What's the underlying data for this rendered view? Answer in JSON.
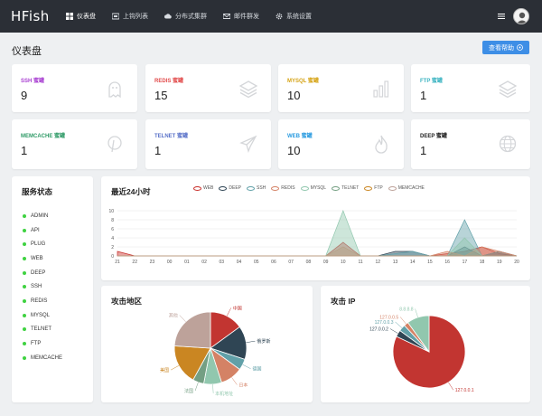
{
  "app": {
    "brand": "HFish"
  },
  "nav": [
    {
      "label": "仪表盘",
      "icon": "dashboard-icon"
    },
    {
      "label": "上钩列表",
      "icon": "hook-icon"
    },
    {
      "label": "分布式集群",
      "icon": "cloud-icon"
    },
    {
      "label": "邮件群发",
      "icon": "mail-icon"
    },
    {
      "label": "系统设置",
      "icon": "gear-icon"
    }
  ],
  "page": {
    "title": "仪表盘",
    "help_button": "查看帮助"
  },
  "stats": [
    {
      "label": "SSH 蜜罐",
      "value": "9",
      "color": "#a83ed1",
      "icon": "ghost-icon"
    },
    {
      "label": "REDIS 蜜罐",
      "value": "15",
      "color": "#e24c4c",
      "icon": "layers-icon"
    },
    {
      "label": "MYSQL 蜜罐",
      "value": "10",
      "color": "#d6a417",
      "icon": "bar-chart-icon"
    },
    {
      "label": "FTP 蜜罐",
      "value": "1",
      "color": "#3db4c2",
      "icon": "layers-icon"
    },
    {
      "label": "MEMCACHE 蜜罐",
      "value": "1",
      "color": "#2e9a66",
      "icon": "pinterest-icon"
    },
    {
      "label": "TELNET 蜜罐",
      "value": "1",
      "color": "#5b73c9",
      "icon": "airplane-icon"
    },
    {
      "label": "WEB 蜜罐",
      "value": "10",
      "color": "#2a9be0",
      "icon": "fire-icon"
    },
    {
      "label": "DEEP 蜜罐",
      "value": "1",
      "color": "#222222",
      "icon": "globe-icon"
    }
  ],
  "services": {
    "title": "服务状态",
    "items": [
      "ADMIN",
      "API",
      "PLUG",
      "WEB",
      "DEEP",
      "SSH",
      "REDIS",
      "MYSQL",
      "TELNET",
      "FTP",
      "MEMCACHE"
    ],
    "status_color": "#3fd241"
  },
  "chart_data": [
    {
      "type": "area",
      "title": "最近24小时",
      "x": [
        "21",
        "22",
        "23",
        "00",
        "01",
        "02",
        "03",
        "04",
        "05",
        "06",
        "07",
        "08",
        "09",
        "10",
        "11",
        "12",
        "13",
        "14",
        "15",
        "16",
        "17",
        "18",
        "19",
        "20"
      ],
      "ylim": [
        0,
        10
      ],
      "yticks": [
        0,
        2,
        4,
        6,
        8,
        10
      ],
      "series": [
        {
          "name": "WEB",
          "color": "#c9302c",
          "values": [
            1,
            0,
            0,
            0,
            0,
            0,
            0,
            0,
            0,
            0,
            0,
            0,
            0,
            3,
            0,
            0,
            0,
            0,
            0,
            0.5,
            1,
            2,
            0.5,
            0
          ]
        },
        {
          "name": "DEEP",
          "color": "#2f4554",
          "values": [
            0,
            0,
            0,
            0,
            0,
            0,
            0,
            0,
            0,
            0,
            0,
            0,
            0,
            0,
            0,
            0,
            1,
            1,
            0,
            0,
            2,
            0,
            1,
            0
          ]
        },
        {
          "name": "SSH",
          "color": "#61a0a8",
          "values": [
            0,
            0,
            0,
            0,
            0,
            0,
            0,
            0,
            0,
            0,
            0,
            0,
            0,
            0,
            0,
            0,
            0.5,
            1,
            0,
            0,
            8,
            0,
            1,
            0
          ]
        },
        {
          "name": "REDIS",
          "color": "#d48265",
          "values": [
            0,
            0,
            0,
            0,
            0,
            0,
            0,
            0,
            0,
            0,
            0,
            0,
            0,
            2,
            0,
            0,
            0,
            0,
            0,
            1,
            0,
            2,
            1,
            0
          ]
        },
        {
          "name": "MYSQL",
          "color": "#91c7ae",
          "values": [
            0,
            0,
            0,
            0,
            0,
            0,
            0,
            0,
            0,
            0,
            0,
            0,
            0,
            10,
            0,
            0,
            0,
            0,
            0,
            0,
            4,
            0,
            0,
            0
          ]
        },
        {
          "name": "TELNET",
          "color": "#749f83",
          "values": [
            0,
            0,
            0,
            0,
            0,
            0,
            0,
            0,
            0,
            0,
            0,
            0,
            0,
            0,
            0,
            0,
            0,
            0,
            0,
            0,
            0,
            0,
            0,
            0
          ]
        },
        {
          "name": "FTP",
          "color": "#ca8622",
          "values": [
            0,
            0,
            0,
            0,
            0,
            0,
            0,
            0,
            0,
            0,
            0,
            0,
            0,
            0,
            0,
            0,
            0,
            0,
            0,
            0,
            0,
            0,
            0,
            0
          ]
        },
        {
          "name": "MEMCACHE",
          "color": "#bda29a",
          "values": [
            0,
            0,
            0,
            0,
            0,
            0,
            0,
            0,
            0,
            0,
            0,
            0,
            0,
            0,
            0,
            0,
            0,
            0,
            0,
            0,
            0,
            0,
            0,
            0
          ]
        }
      ]
    },
    {
      "type": "pie",
      "title": "攻击地区",
      "slices": [
        {
          "label": "中国",
          "value": 15,
          "color": "#c23531"
        },
        {
          "label": "俄罗斯",
          "value": 15,
          "color": "#2f4554"
        },
        {
          "label": "德国",
          "value": 5,
          "color": "#61a0a8"
        },
        {
          "label": "日本",
          "value": 10,
          "color": "#d48265"
        },
        {
          "label": "本机地址",
          "value": 8,
          "color": "#91c7ae"
        },
        {
          "label": "法国",
          "value": 5,
          "color": "#749f83"
        },
        {
          "label": "美国",
          "value": 18,
          "color": "#ca8622"
        },
        {
          "label": "其他",
          "value": 24,
          "color": "#bda29a"
        }
      ]
    },
    {
      "type": "pie",
      "title": "攻击 IP",
      "slices": [
        {
          "label": "127.0.0.1",
          "value": 82,
          "color": "#c23531"
        },
        {
          "label": "127.0.0.2",
          "value": 3,
          "color": "#2f4554"
        },
        {
          "label": "127.0.0.3",
          "value": 3,
          "color": "#61a0a8"
        },
        {
          "label": "127.0.0.5",
          "value": 2,
          "color": "#d48265"
        },
        {
          "label": "8.8.8.8",
          "value": 10,
          "color": "#91c7ae"
        }
      ]
    }
  ]
}
